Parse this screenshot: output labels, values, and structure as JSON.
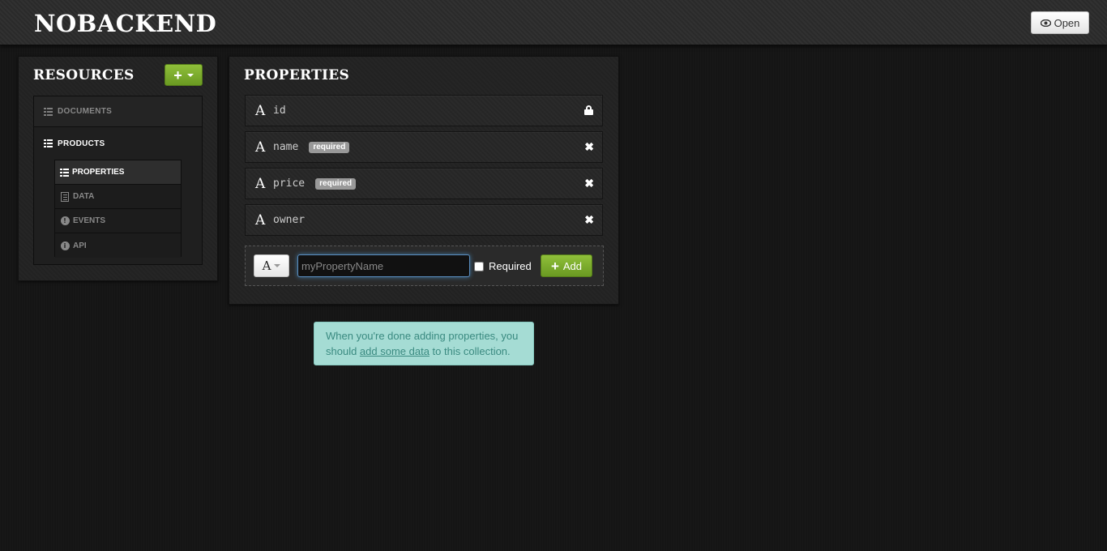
{
  "header": {
    "brand": "NOBACKEND",
    "open_label": "Open"
  },
  "resources": {
    "title": "RESOURCES",
    "add_button": "+",
    "items": [
      {
        "label": "DOCUMENTS",
        "icon": "list-icon"
      },
      {
        "label": "PRODUCTS",
        "icon": "list-icon"
      }
    ],
    "sub_items": [
      {
        "label": "PROPERTIES",
        "icon": "list-icon",
        "active": true
      },
      {
        "label": "DATA",
        "icon": "document-icon"
      },
      {
        "label": "EVENTS",
        "icon": "exclamation-icon"
      },
      {
        "label": "API",
        "icon": "info-icon"
      }
    ]
  },
  "properties": {
    "title": "PROPERTIES",
    "type_glyph": "A",
    "rows": [
      {
        "name": "id",
        "required": false,
        "action": "lock-icon"
      },
      {
        "name": "name",
        "required": true,
        "badge": "required",
        "action": "remove-icon"
      },
      {
        "name": "price",
        "required": true,
        "badge": "required",
        "action": "remove-icon"
      },
      {
        "name": "owner",
        "required": false,
        "action": "remove-icon"
      }
    ],
    "add_form": {
      "type_value": "A",
      "name_placeholder": "myPropertyName",
      "required_label": "Required",
      "add_label": "Add"
    }
  },
  "info": {
    "before": "When you're done adding properties, you should ",
    "link": "add some data",
    "after": " to this collection."
  },
  "colors": {
    "accent_green": "#7aab2c",
    "info_bg": "#a5dcd4",
    "info_text": "#3a8a80"
  }
}
